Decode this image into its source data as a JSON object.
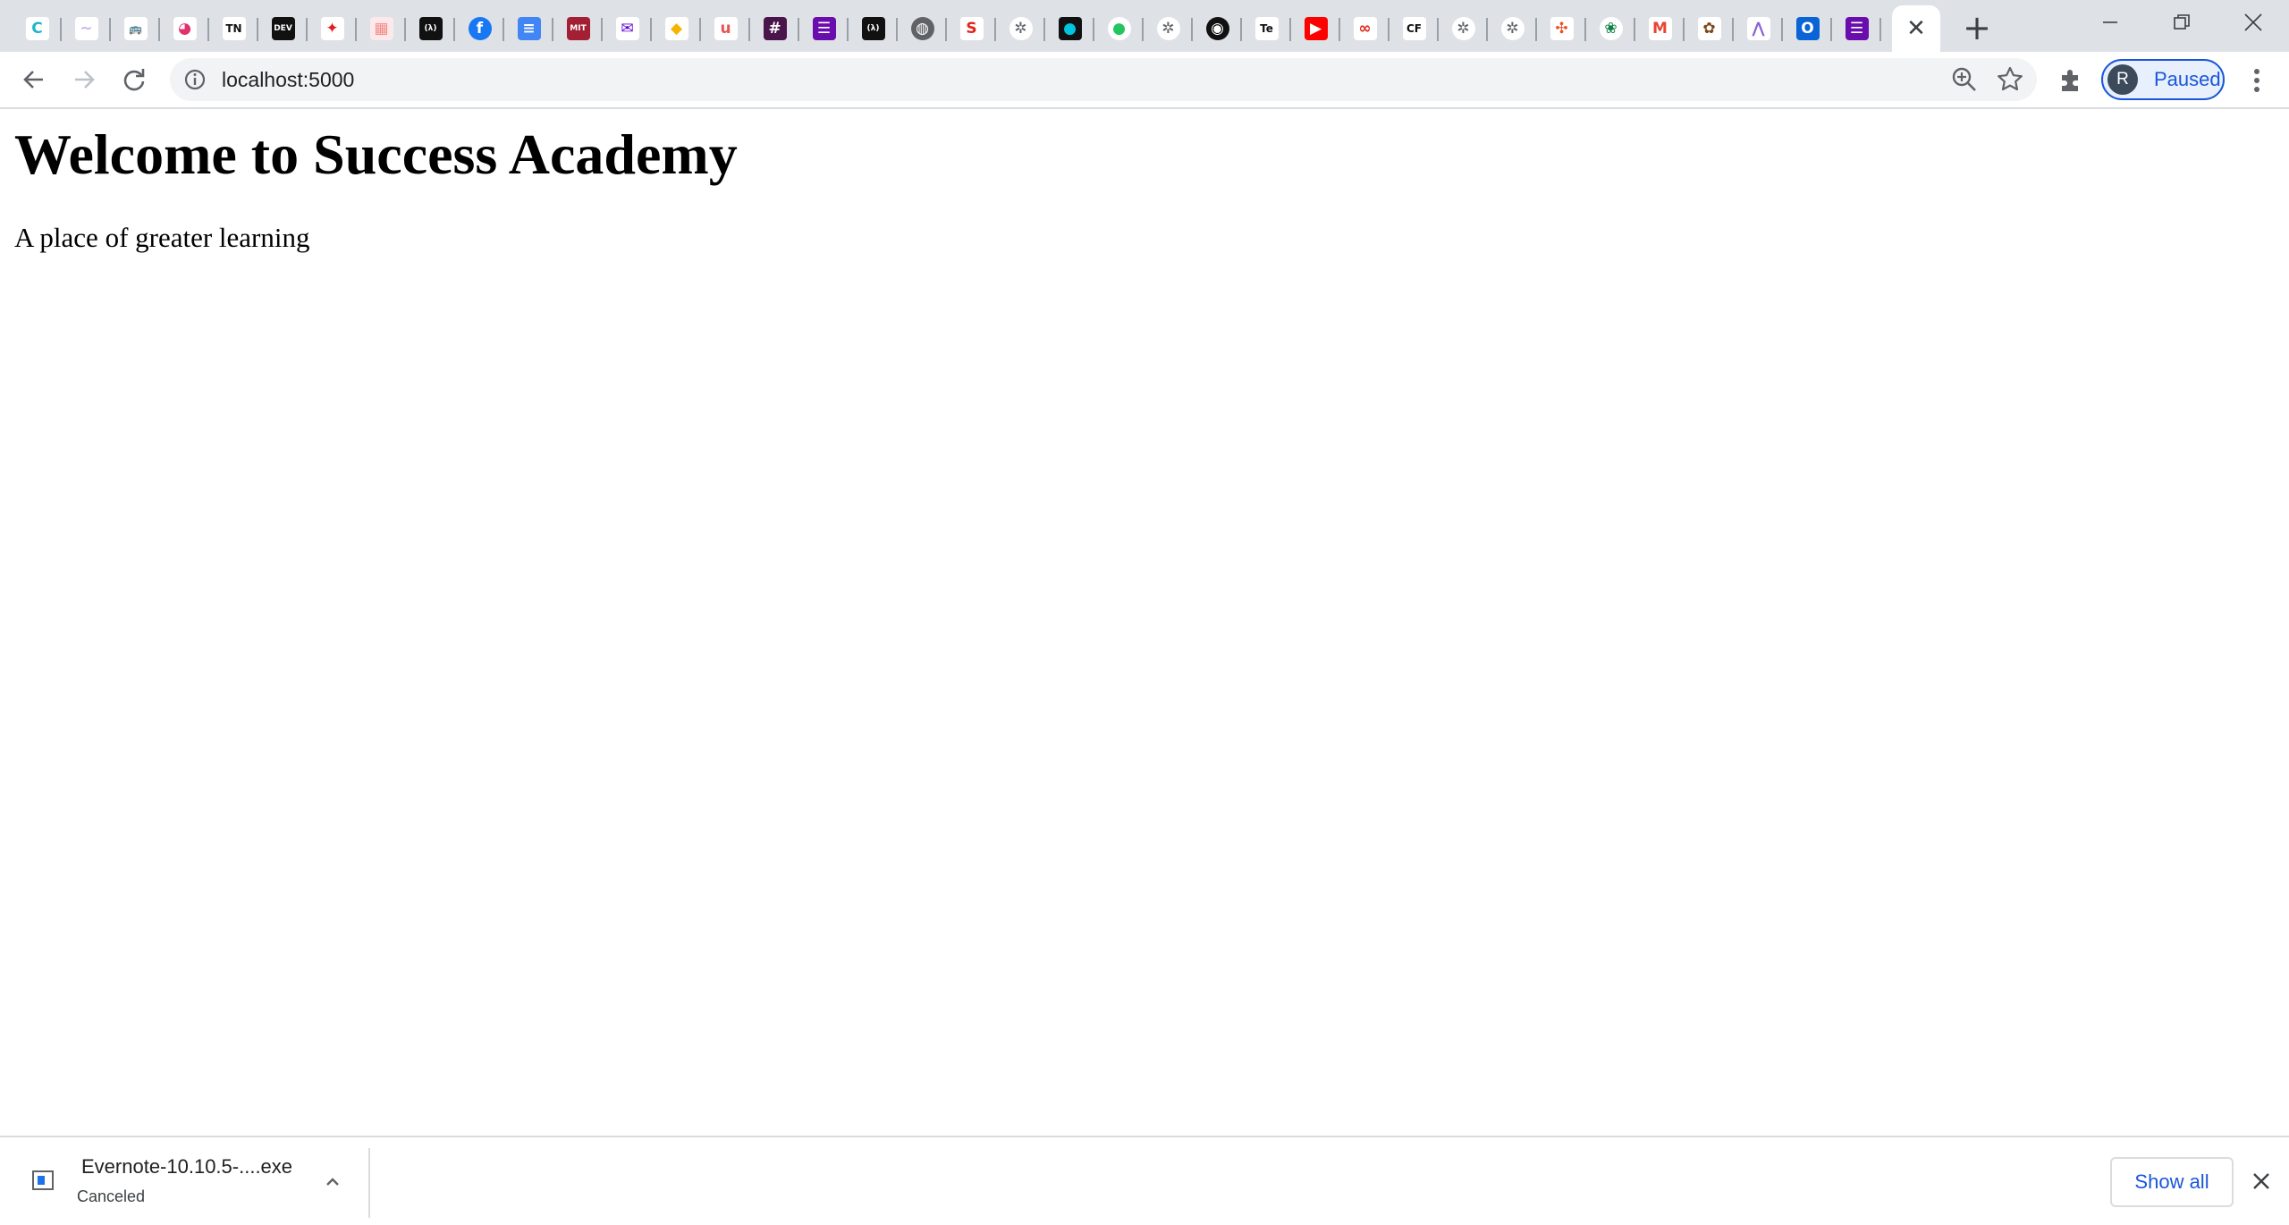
{
  "browser": {
    "tabs": [
      {
        "icon": "codesandbox-c-icon",
        "glyph": "C",
        "bg": "#ffffff",
        "fg": "#1fb6c9"
      },
      {
        "icon": "feather-icon",
        "glyph": "~",
        "bg": "#ffffff",
        "fg": "#c9b6e8"
      },
      {
        "icon": "car-icon",
        "glyph": "🚌",
        "bg": "#ffffff",
        "fg": "#333333"
      },
      {
        "icon": "globe-colored-icon",
        "glyph": "◕",
        "bg": "#ffffff",
        "fg": "#e1306c"
      },
      {
        "icon": "tn-icon",
        "glyph": "TN",
        "bg": "#ffffff",
        "fg": "#111111"
      },
      {
        "icon": "dev-icon",
        "glyph": "DEV",
        "bg": "#111111",
        "fg": "#ffffff"
      },
      {
        "icon": "maple-leaf-icon",
        "glyph": "✦",
        "bg": "#ffffff",
        "fg": "#e41c23"
      },
      {
        "icon": "colorful-square-icon",
        "glyph": "▦",
        "bg": "#fde8ec",
        "fg": "#f28b82"
      },
      {
        "icon": "freecodecamp-icon",
        "glyph": "(λ)",
        "bg": "#111111",
        "fg": "#ffffff"
      },
      {
        "icon": "facebook-icon",
        "glyph": "f",
        "bg": "#1877f2",
        "fg": "#ffffff",
        "round": true
      },
      {
        "icon": "google-docs-icon",
        "glyph": "≡",
        "bg": "#4285f4",
        "fg": "#ffffff"
      },
      {
        "icon": "mit-ocw-icon",
        "glyph": "MIT",
        "bg": "#a31f34",
        "fg": "#ffffff"
      },
      {
        "icon": "mail-icon",
        "glyph": "✉",
        "bg": "#ffffff",
        "fg": "#6001d2"
      },
      {
        "icon": "shield-icon",
        "glyph": "◆",
        "bg": "#ffffff",
        "fg": "#f5b400"
      },
      {
        "icon": "udemy-icon",
        "glyph": "u",
        "bg": "#ffffff",
        "fg": "#ec5252"
      },
      {
        "icon": "slack-icon",
        "glyph": "#",
        "bg": "#4a154b",
        "fg": "#ffffff"
      },
      {
        "icon": "list-icon",
        "glyph": "☰",
        "bg": "#6a0dad",
        "fg": "#ffffff"
      },
      {
        "icon": "freecodecamp-icon",
        "glyph": "(λ)",
        "bg": "#111111",
        "fg": "#ffffff"
      },
      {
        "icon": "globe-icon",
        "glyph": "◍",
        "bg": "#5f6368",
        "fg": "#ffffff",
        "round": true
      },
      {
        "icon": "s-logo-icon",
        "glyph": "S",
        "bg": "#ffffff",
        "fg": "#e2231a"
      },
      {
        "icon": "default-globe-icon",
        "glyph": "✲",
        "bg": "#ffffff",
        "fg": "#5f6368",
        "round": true
      },
      {
        "icon": "cyan-dot-icon",
        "glyph": "●",
        "bg": "#111111",
        "fg": "#00c4e0"
      },
      {
        "icon": "teal-circle-icon",
        "glyph": "●",
        "bg": "#ffffff",
        "fg": "#22c55e",
        "round": true
      },
      {
        "icon": "default-globe-icon",
        "glyph": "✲",
        "bg": "#ffffff",
        "fg": "#5f6368",
        "round": true
      },
      {
        "icon": "github-icon",
        "glyph": "◉",
        "bg": "#111111",
        "fg": "#ffffff",
        "round": true
      },
      {
        "icon": "te-icon",
        "glyph": "Te",
        "bg": "#ffffff",
        "fg": "#111111"
      },
      {
        "icon": "youtube-icon",
        "glyph": "▶",
        "bg": "#ff0000",
        "fg": "#ffffff"
      },
      {
        "icon": "glasses-icon",
        "glyph": "∞",
        "bg": "#ffffff",
        "fg": "#e2231a"
      },
      {
        "icon": "cf-icon",
        "glyph": "CF",
        "bg": "#ffffff",
        "fg": "#111111"
      },
      {
        "icon": "default-globe-icon",
        "glyph": "✲",
        "bg": "#ffffff",
        "fg": "#5f6368",
        "round": true
      },
      {
        "icon": "default-globe-icon",
        "glyph": "✲",
        "bg": "#ffffff",
        "fg": "#5f6368",
        "round": true
      },
      {
        "icon": "figma-icon",
        "glyph": "✣",
        "bg": "#ffffff",
        "fg": "#f24e1e"
      },
      {
        "icon": "crest-icon",
        "glyph": "❀",
        "bg": "#ffffff",
        "fg": "#0b8043",
        "round": true
      },
      {
        "icon": "gmail-icon",
        "glyph": "M",
        "bg": "#ffffff",
        "fg": "#ea4335"
      },
      {
        "icon": "crest-icon",
        "glyph": "✿",
        "bg": "#ffffff",
        "fg": "#7a4a1a"
      },
      {
        "icon": "chart-icon",
        "glyph": "⋀",
        "bg": "#ffffff",
        "fg": "#8a63d2"
      },
      {
        "icon": "outlook-icon",
        "glyph": "O",
        "bg": "#0a64d6",
        "fg": "#ffffff"
      },
      {
        "icon": "list-icon",
        "glyph": "☰",
        "bg": "#6a0dad",
        "fg": "#ffffff"
      }
    ],
    "active_tab_close": "✕",
    "new_tab": "+",
    "window_controls": {
      "minimize": "—",
      "restore": "❐",
      "close": "✕"
    },
    "address": "localhost:5000",
    "profile": {
      "initial": "R",
      "status": "Paused"
    }
  },
  "page": {
    "heading": "Welcome to Success Academy",
    "subtitle": "A place of greater learning"
  },
  "downloads": {
    "file_name": "Evernote-10.10.5-....exe",
    "status": "Canceled",
    "show_all": "Show all"
  }
}
